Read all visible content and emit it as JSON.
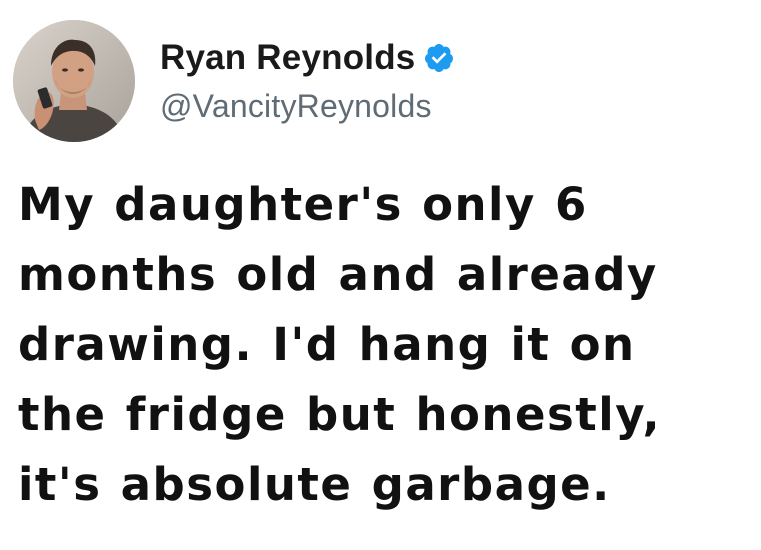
{
  "author": {
    "display_name": "Ryan Reynolds",
    "handle": "@VancityReynolds",
    "verified": true,
    "verified_badge_icon": "verified-check-icon",
    "avatar_icon": "profile-photo"
  },
  "tweet": {
    "text_lines": [
      "My daughter's only 6",
      "months old and already",
      "drawing. I'd hang it on",
      "the fridge but honestly,",
      "it's absolute garbage."
    ]
  },
  "colors": {
    "background": "#ffffff",
    "name": "#1a1a1a",
    "handle": "#5f6b75",
    "text": "#111111",
    "verified_badge": "#1d9bf0"
  }
}
